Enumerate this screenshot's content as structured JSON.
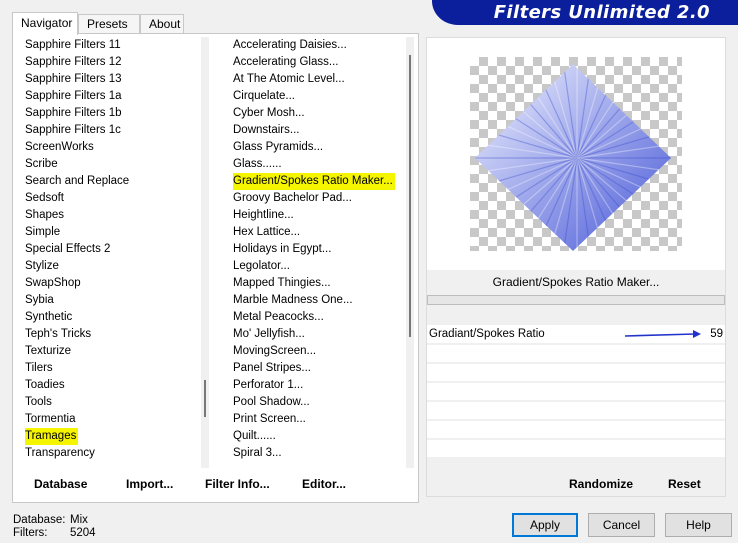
{
  "tabs": [
    {
      "label": "Navigator",
      "active": true
    },
    {
      "label": "Presets",
      "active": false
    },
    {
      "label": "About",
      "active": false
    }
  ],
  "logo_text": "Filters Unlimited 2.0",
  "categories": {
    "selected": "Tramages",
    "items": [
      "Sapphire Filters 11",
      "Sapphire Filters 12",
      "Sapphire Filters 13",
      "Sapphire Filters 1a",
      "Sapphire Filters 1b",
      "Sapphire Filters 1c",
      "ScreenWorks",
      "Scribe",
      "Search and Replace",
      "Sedsoft",
      "Shapes",
      "Simple",
      "Special Effects 2",
      "Stylize",
      "SwapShop",
      "Sybia",
      "Synthetic",
      "Teph's Tricks",
      "Texturize",
      "Tilers",
      "Toadies",
      "Tools",
      "Tormentia",
      "Tramages",
      "Transparency"
    ]
  },
  "filters": {
    "selected": "Gradient/Spokes Ratio Maker...",
    "items": [
      "Accelerating Daisies...",
      "Accelerating Glass...",
      "At The Atomic Level...",
      "Cirquelate...",
      "Cyber Mosh...",
      "Downstairs...",
      "Glass Pyramids...",
      "Glass......",
      "Gradient/Spokes Ratio Maker...",
      "Groovy Bachelor Pad...",
      "Heightline...",
      "Hex Lattice...",
      "Holidays in Egypt...",
      "Legolator...",
      "Mapped Thingies...",
      "Marble Madness One...",
      "Metal Peacocks...",
      "Mo' Jellyfish...",
      "MovingScreen...",
      "Panel Stripes...",
      "Perforator 1...",
      "Pool Shadow...",
      "Print Screen...",
      "Quilt......",
      "Spiral 3..."
    ]
  },
  "buttons": {
    "database": "Database",
    "import": "Import...",
    "filter_info": "Filter Info...",
    "editor": "Editor...",
    "randomize": "Randomize",
    "reset": "Reset",
    "apply": "Apply",
    "cancel": "Cancel",
    "help": "Help"
  },
  "preview": {
    "filter_name": "Gradient/Spokes Ratio Maker..."
  },
  "parameter": {
    "label": "Gradiant/Spokes Ratio",
    "value": "59"
  },
  "status": {
    "database_label": "Database:",
    "database_value": "Mix",
    "filters_label": "Filters:",
    "filters_value": "5204"
  },
  "colors": {
    "logo_bg": "#0b1f9c",
    "highlight": "#f5f500",
    "arrow": "#2233cc"
  }
}
